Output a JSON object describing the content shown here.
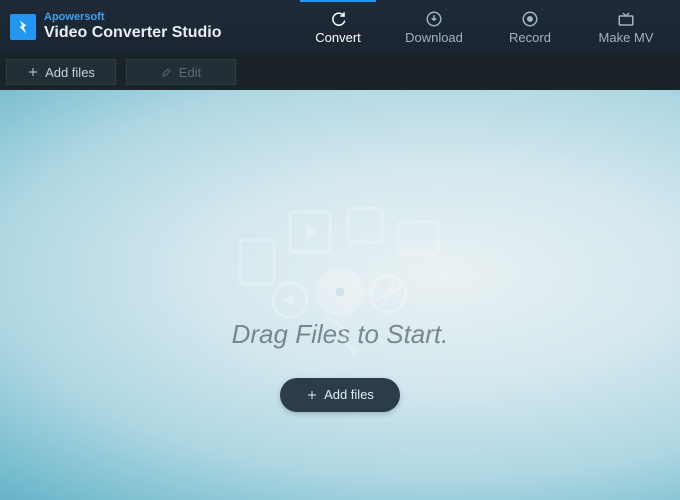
{
  "brand": "Apowersoft",
  "product": "Video Converter Studio",
  "nav": {
    "convert": "Convert",
    "download": "Download",
    "record": "Record",
    "makemv": "Make MV"
  },
  "toolbar": {
    "add_files": "Add files",
    "edit": "Edit"
  },
  "stage": {
    "hint": "Drag Files to Start.",
    "add_files": "Add files"
  }
}
